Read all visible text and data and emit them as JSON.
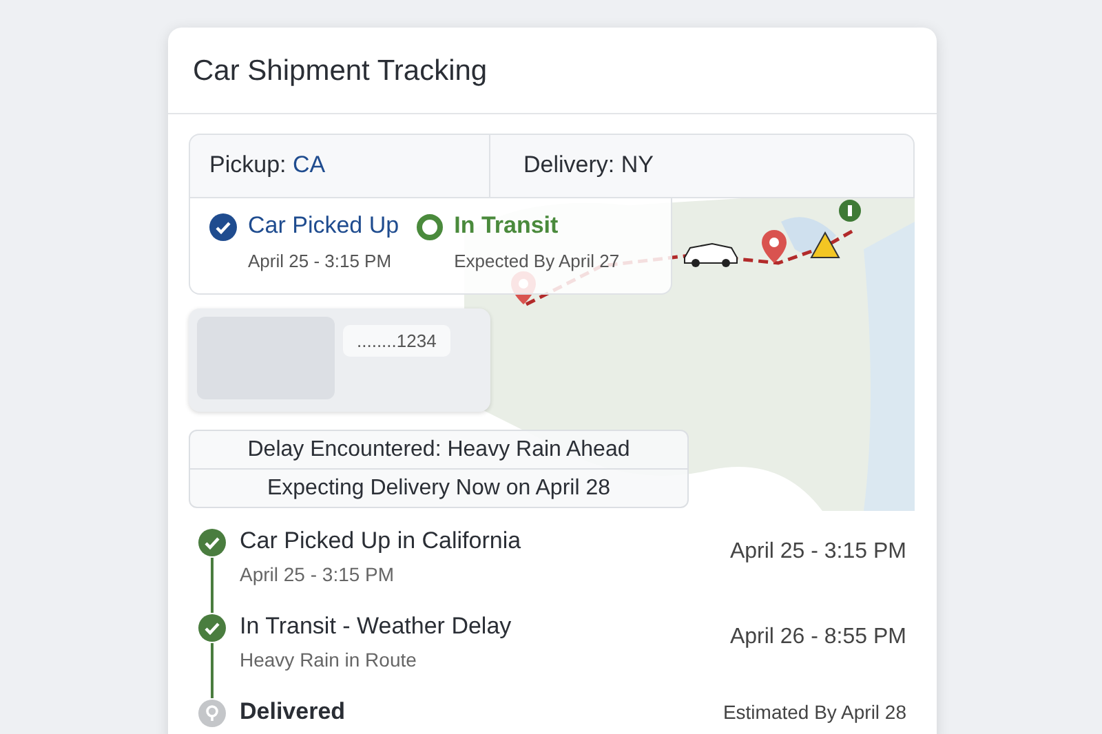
{
  "title": "Car Shipment Tracking",
  "route": {
    "pickup_label": "Pickup:",
    "pickup": "CA",
    "delivery_label": "Delivery:",
    "delivery": "NY"
  },
  "progress": [
    {
      "kind": "done",
      "title": "Car Picked Up",
      "detail": "April 25 - 3:15 PM"
    },
    {
      "kind": "current",
      "title": "In Transit",
      "detail": "Expected By April 27"
    }
  ],
  "vehicle": {
    "masked_number": "........1234"
  },
  "alerts": [
    "Delay Encountered: Heavy Rain Ahead",
    "Expecting Delivery Now on April 28"
  ],
  "timeline": [
    {
      "kind": "done",
      "title": "Car Picked Up in California",
      "detail": "April 25 - 3:15 PM",
      "time": "April 25 - 3:15 PM"
    },
    {
      "kind": "done",
      "title": "In Transit - Weather Delay",
      "detail": "Heavy Rain in Route",
      "time": "April 26 - 8:55 PM"
    },
    {
      "kind": "pending",
      "title": "Delivered",
      "time": "Estimated By April 28"
    }
  ]
}
